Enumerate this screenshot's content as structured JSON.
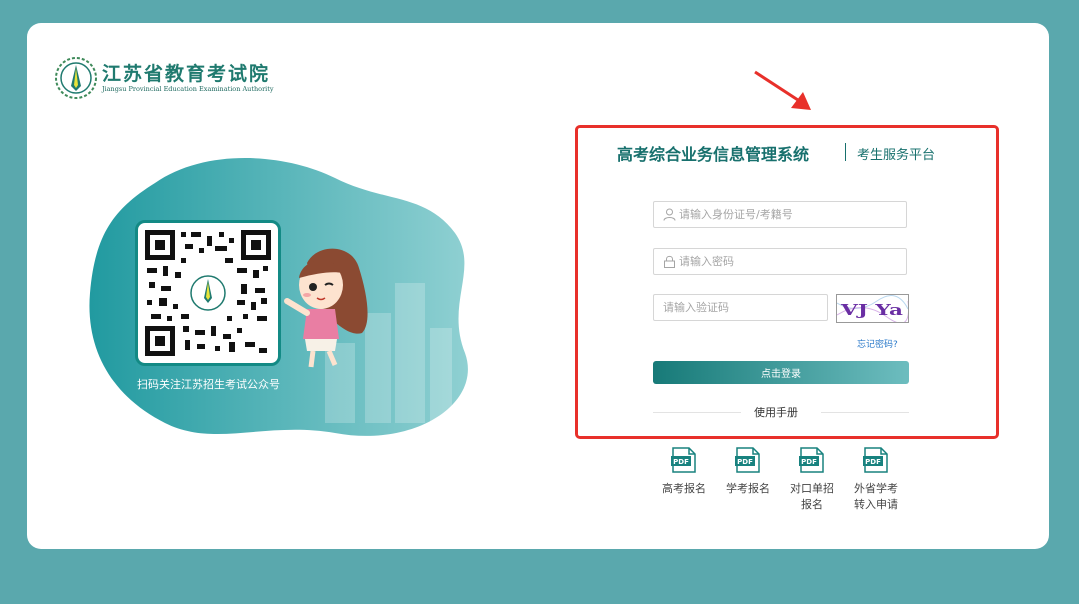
{
  "logo": {
    "name_cn": "江苏省教育考试院",
    "name_en": "Jiangsu Provincial Education Examination Authority"
  },
  "left_panel": {
    "qr_caption": "扫码关注江苏招生考试公众号"
  },
  "login": {
    "system_title": "高考综合业务信息管理系统",
    "platform": "考生服务平台",
    "id_placeholder": "请输入身份证号/考籍号",
    "password_placeholder": "请输入密码",
    "captcha_placeholder": "请输入验证码",
    "captcha_text": "VJ Ya",
    "forgot_password": "忘记密码?",
    "login_button": "点击登录",
    "manual": "使用手册"
  },
  "pdf_label": "PDF",
  "downloads": [
    {
      "line1": "高考报名",
      "line2": ""
    },
    {
      "line1": "学考报名",
      "line2": ""
    },
    {
      "line1": "对口单招",
      "line2": "报名"
    },
    {
      "line1": "外省学考",
      "line2": "转入申请"
    }
  ],
  "colors": {
    "page_bg": "#5aa8ad",
    "brand_teal": "#17706d",
    "highlight_red": "#e8302a",
    "link_blue": "#2a79c9"
  }
}
